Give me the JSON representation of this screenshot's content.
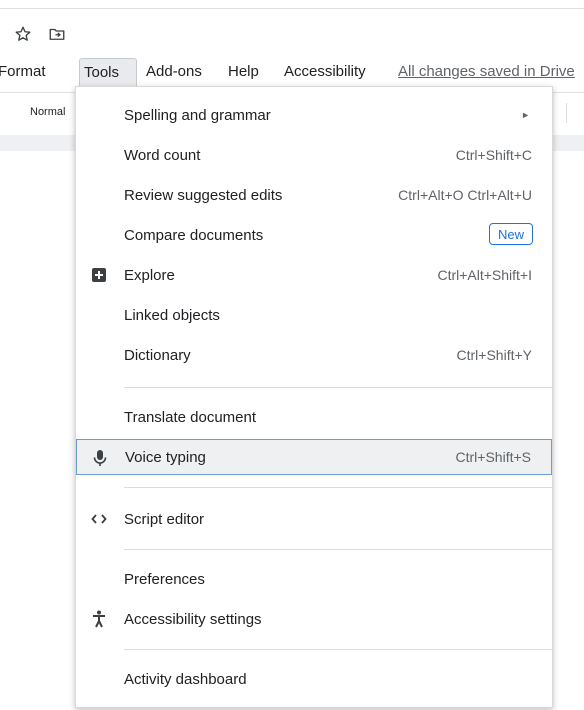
{
  "menubar": {
    "format": "Format",
    "tools": "Tools",
    "addons": "Add-ons",
    "help": "Help",
    "accessibility": "Accessibility",
    "saved_status": "All changes saved in Drive"
  },
  "toolbar": {
    "style": "Normal"
  },
  "tools_menu": {
    "spelling": "Spelling and grammar",
    "word_count": {
      "label": "Word count",
      "shortcut": "Ctrl+Shift+C"
    },
    "review_edits": {
      "label": "Review suggested edits",
      "shortcut": "Ctrl+Alt+O Ctrl+Alt+U"
    },
    "compare": {
      "label": "Compare documents",
      "badge": "New"
    },
    "explore": {
      "label": "Explore",
      "shortcut": "Ctrl+Alt+Shift+I"
    },
    "linked_objects": {
      "label": "Linked objects"
    },
    "dictionary": {
      "label": "Dictionary",
      "shortcut": "Ctrl+Shift+Y"
    },
    "translate": {
      "label": "Translate document"
    },
    "voice_typing": {
      "label": "Voice typing",
      "shortcut": "Ctrl+Shift+S"
    },
    "script_editor": {
      "label": "Script editor"
    },
    "preferences": {
      "label": "Preferences"
    },
    "accessibility_settings": {
      "label": "Accessibility settings"
    },
    "activity_dashboard": {
      "label": "Activity dashboard"
    }
  },
  "icons": {
    "explore": "explore-icon",
    "voice_typing": "microphone-icon",
    "script_editor": "code-brackets-icon",
    "accessibility_settings": "accessibility-person-icon"
  },
  "colors": {
    "accent": "#1a73e8",
    "highlight_border": "#6b9bd8"
  }
}
